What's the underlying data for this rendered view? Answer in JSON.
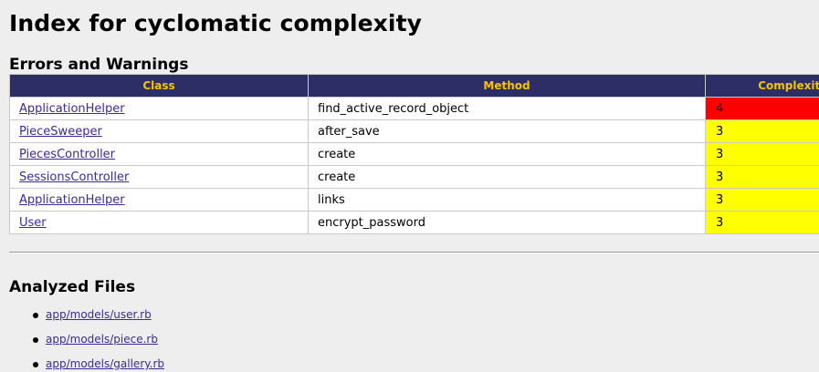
{
  "page_title": "Index for cyclomatic complexity",
  "errors_section": {
    "title": "Errors and Warnings",
    "columns": [
      "Class",
      "Method",
      "Complexity"
    ],
    "rows": [
      {
        "class": "ApplicationHelper",
        "method": "find_active_record_object",
        "complexity": "4",
        "severity_color": "#ff0000"
      },
      {
        "class": "PieceSweeper",
        "method": "after_save",
        "complexity": "3",
        "severity_color": "#ffff00"
      },
      {
        "class": "PiecesController",
        "method": "create",
        "complexity": "3",
        "severity_color": "#ffff00"
      },
      {
        "class": "SessionsController",
        "method": "create",
        "complexity": "3",
        "severity_color": "#ffff00"
      },
      {
        "class": "ApplicationHelper",
        "method": "links",
        "complexity": "3",
        "severity_color": "#ffff00"
      },
      {
        "class": "User",
        "method": "encrypt_password",
        "complexity": "3",
        "severity_color": "#ffff00"
      }
    ]
  },
  "files_section": {
    "title": "Analyzed Files",
    "files": [
      "app/models/user.rb",
      "app/models/piece.rb",
      "app/models/gallery.rb"
    ]
  },
  "colors": {
    "header_bg": "#2e2e66",
    "header_text": "#f5c400",
    "link": "#3b2a9a",
    "severity_error": "#ff0000",
    "severity_warning": "#ffff00"
  }
}
